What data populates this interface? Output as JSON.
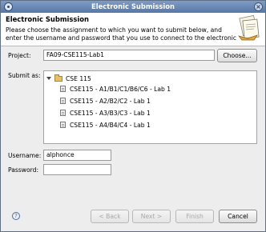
{
  "window": {
    "title": "Electronic Submission"
  },
  "header": {
    "title": "Electronic Submission",
    "description": "Please choose the assignment to which you want to submit below, and enter the username and password that you use to connect to the electronic"
  },
  "project": {
    "label": "Project:",
    "value": "FA09-CSE115-Lab1",
    "choose_label": "Choose..."
  },
  "submit_as": {
    "label": "Submit as:",
    "root": "CSE 115",
    "items": [
      "CSE115 - A1/B1/C1/B6/C6 - Lab 1",
      "CSE115 - A2/B2/C2 - Lab 1",
      "CSE115 - A3/B3/C3 - Lab 1",
      "CSE115 - A4/B4/C4 - Lab 1"
    ]
  },
  "username": {
    "label": "Username:",
    "value": "alphonce"
  },
  "password": {
    "label": "Password:",
    "value": ""
  },
  "buttons": {
    "back": "< Back",
    "next": "Next >",
    "finish": "Finish",
    "cancel": "Cancel"
  },
  "icons": {
    "window": "app-icon",
    "close": "close-icon",
    "help": "help-icon",
    "folder": "folder-icon",
    "file": "file-icon",
    "wizard": "wizard-banner-icon"
  }
}
